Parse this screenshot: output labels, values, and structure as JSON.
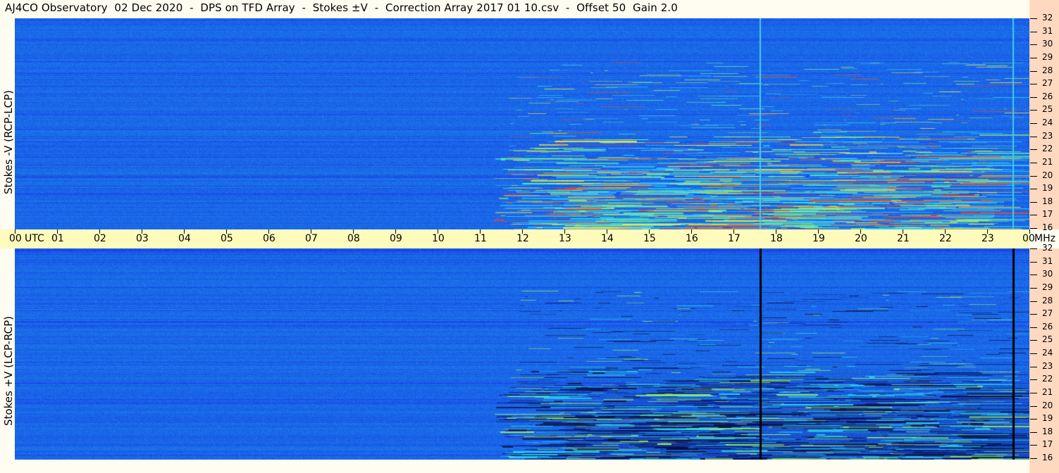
{
  "title": "AJ4CO Observatory  02 Dec 2020  -  DPS on TFD Array  -  Stokes ±V  -  Correction Array 2017 01 10.csv  -  Offset 50  Gain 2.0",
  "chart_data": {
    "type": "heatmap",
    "title": "AJ4CO Observatory  02 Dec 2020  -  DPS on TFD Array  -  Stokes ±V  -  Correction Array 2017 01 10.csv  -  Offset 50  Gain 2.0",
    "x_axis": {
      "unit_label": "UTC",
      "ticks": [
        "00",
        "01",
        "02",
        "03",
        "04",
        "05",
        "06",
        "07",
        "08",
        "09",
        "10",
        "11",
        "12",
        "13",
        "14",
        "15",
        "16",
        "17",
        "18",
        "19",
        "20",
        "21",
        "22",
        "23",
        "00"
      ],
      "range": [
        0,
        24
      ]
    },
    "y_axis": {
      "unit_label": "MHz",
      "ticks": [
        "16",
        "17",
        "18",
        "19",
        "20",
        "21",
        "22",
        "23",
        "24",
        "25",
        "26",
        "27",
        "28",
        "29",
        "30",
        "31",
        "32"
      ],
      "range": [
        16,
        32
      ]
    },
    "panels": [
      {
        "name": "top",
        "ylabel": "Stokes -V (RCP-LCP)"
      },
      {
        "name": "bottom",
        "ylabel": "Stokes +V (LCP-RCP)"
      }
    ],
    "colormap": {
      "background": "#1a68e8",
      "activity": [
        "#2ad6f0",
        "#9cf268",
        "#f6ea44",
        "#e84a2a"
      ],
      "dark": "#08104a"
    }
  }
}
